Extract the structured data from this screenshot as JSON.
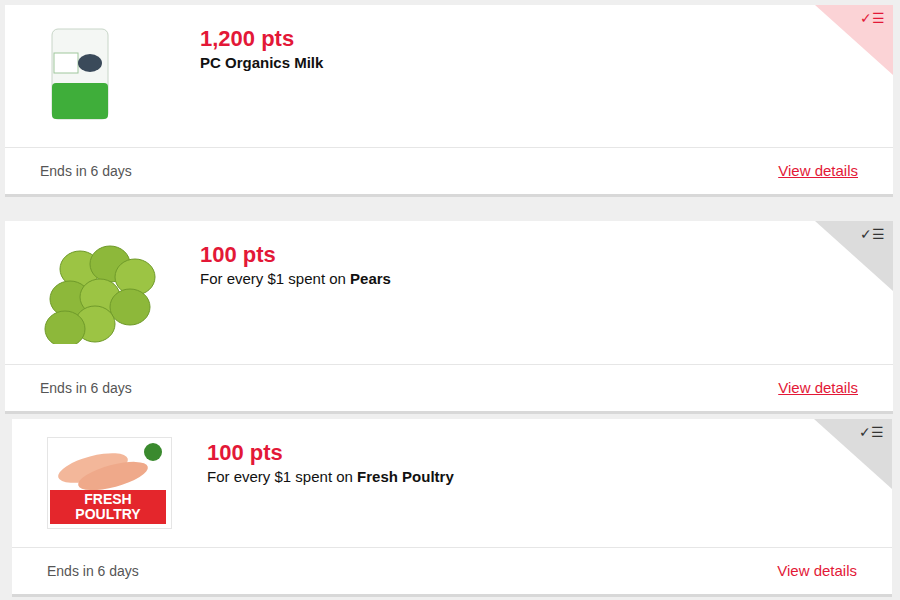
{
  "offers": [
    {
      "kind": "fixed",
      "points": "1,200 pts",
      "item": "PC Organics Milk",
      "image": "milk",
      "ends": "Ends in 6 days",
      "link": "View details",
      "link_underlined": true,
      "corner_icon": "✓☰",
      "loaded": true
    },
    {
      "kind": "per_dollar",
      "points": "100 pts",
      "prefix": "For every $1 spent on ",
      "item": "Pears",
      "image": "pears",
      "ends": "Ends in 6 days",
      "link": "View details",
      "link_underlined": true,
      "corner_icon": "✓☰",
      "loaded": false
    },
    {
      "kind": "per_dollar",
      "points": "100 pts",
      "prefix": "For every $1 spent on ",
      "item": "Fresh Poultry",
      "image": "poultry",
      "image_label": "FRESH POULTRY",
      "ends": "Ends in 6 days",
      "link": "View details",
      "link_underlined": false,
      "corner_icon": "✓☰",
      "loaded": false
    }
  ]
}
